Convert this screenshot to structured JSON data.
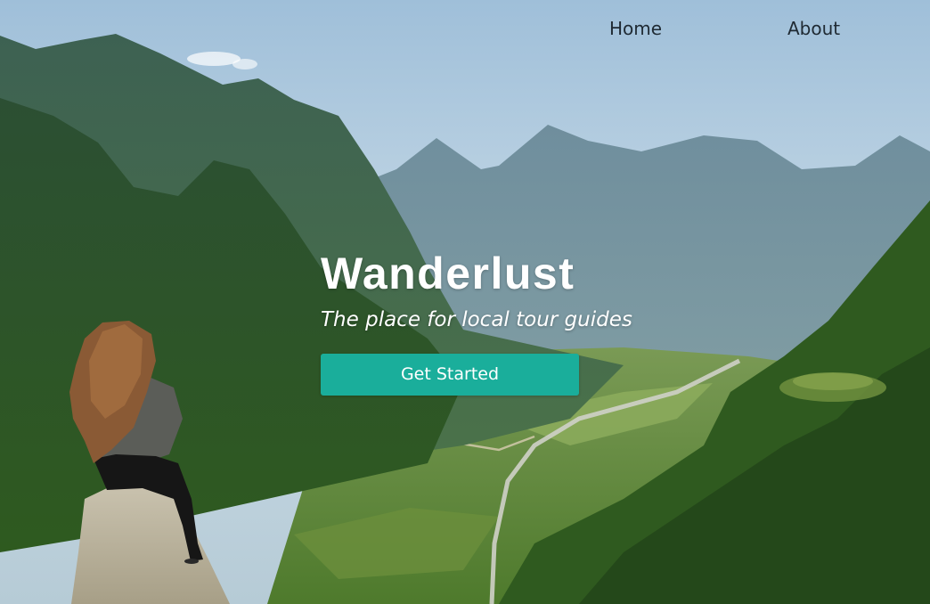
{
  "nav": {
    "items": [
      {
        "label": "Home"
      },
      {
        "label": "About"
      }
    ]
  },
  "hero": {
    "title": "Wanderlust",
    "tagline": "The place for local tour guides",
    "cta_label": "Get Started",
    "image": "mountain-valley-hiker-photo"
  },
  "colors": {
    "accent": "#1aae9b",
    "nav_text": "#1f2a33",
    "hero_text": "#ffffff"
  }
}
